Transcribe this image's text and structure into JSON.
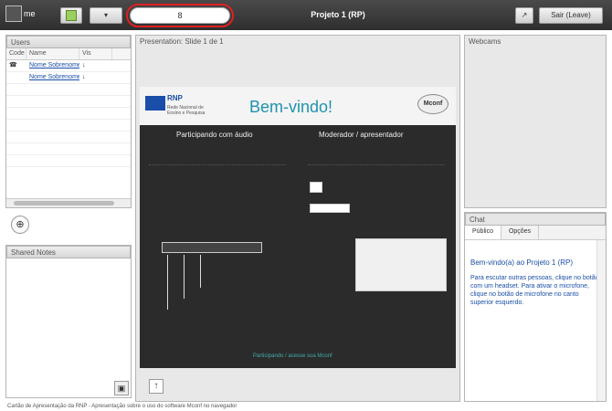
{
  "header": {
    "logo_text": "me",
    "title": "Projeto 1 (RP)",
    "url_text": "8",
    "settings_label": "▾",
    "logout_label": "Sair (Leave)",
    "icon_label": "↗"
  },
  "users": {
    "title": "Users",
    "columns": [
      "Code",
      "Name",
      "Vis"
    ],
    "rows": [
      {
        "icon": "☎",
        "name": "Nome Sobrenome",
        "status": "↓"
      },
      {
        "icon": "",
        "name": "Nome Sobrenome",
        "status": "↓"
      }
    ],
    "target_icon": "⊕"
  },
  "notes": {
    "title": "Shared Notes",
    "lock_icon": "▣"
  },
  "presentation": {
    "title": "Presentation: Slide 1 de 1",
    "upload_icon": "↑",
    "slide": {
      "org_title": "RNP",
      "org_sub": "Rede Nacional de Ensino e Pesquisa",
      "welcome": "Bem-vindo!",
      "logo": "Mconf",
      "left_heading": "Participando com áudio",
      "right_heading": "Moderador / apresentador",
      "footer": "Participando / acesse sua Mconf"
    }
  },
  "webcams": {
    "title": "Webcams"
  },
  "chat": {
    "title": "Chat",
    "tabs": [
      "Público",
      "Opções"
    ],
    "welcome": "Bem-vindo(a) ao Projeto 1 (RP)",
    "message": "Para escutar outras pessoas, clique no botão com um headset. Para ativar o microfone, clique no botão de microfone no canto superior esquerdo."
  },
  "status_bar": {
    "text": "Cartão de Apresentação da RNP - Apresentação sobre o uso do software Mconf no navegador"
  },
  "colors": {
    "topbar": "#3a3a3a",
    "highlight_ring": "#e02020",
    "link": "#1a4ea8",
    "accent": "#1f93ad"
  }
}
